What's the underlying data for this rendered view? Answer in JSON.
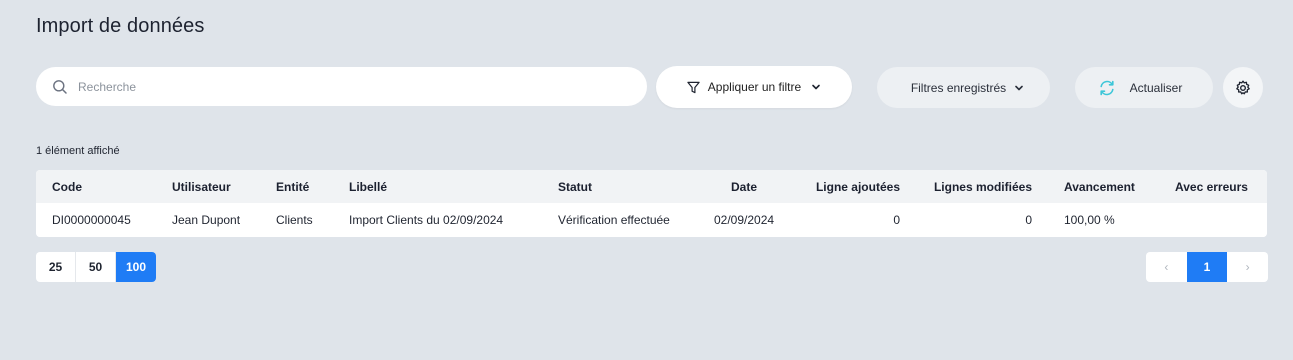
{
  "page": {
    "title": "Import de données"
  },
  "search": {
    "placeholder": "Recherche",
    "value": ""
  },
  "toolbar": {
    "filter_label": "Appliquer un filtre",
    "saved_filters_label": "Filtres enregistrés",
    "refresh_label": "Actualiser"
  },
  "count_label": "1 élément affiché",
  "table": {
    "headers": {
      "code": "Code",
      "user": "Utilisateur",
      "entity": "Entité",
      "label": "Libellé",
      "status": "Statut",
      "date": "Date",
      "added": "Ligne ajoutées",
      "modified": "Lignes modifiées",
      "progress": "Avancement",
      "errors": "Avec erreurs"
    },
    "rows": [
      {
        "code": "DI0000000045",
        "user": "Jean Dupont",
        "entity": "Clients",
        "label": "Import Clients du 02/09/2024",
        "status": "Vérification effectuée",
        "date": "02/09/2024",
        "added": "0",
        "modified": "0",
        "progress": "100,00 %",
        "errors": ""
      }
    ]
  },
  "pagination": {
    "page_sizes": [
      "25",
      "50",
      "100"
    ],
    "selected_page_size": "100",
    "prev": "‹",
    "current_page": "1",
    "next": "›"
  },
  "icons": {
    "search": "search-icon",
    "filter": "filter-icon",
    "chevron": "chevron-down-icon",
    "refresh": "refresh-icon",
    "settings": "gear-icon"
  },
  "colors": {
    "accent": "#1f7cf5",
    "refresh_icon": "#3cc6d8",
    "background": "#dfe4ea"
  }
}
